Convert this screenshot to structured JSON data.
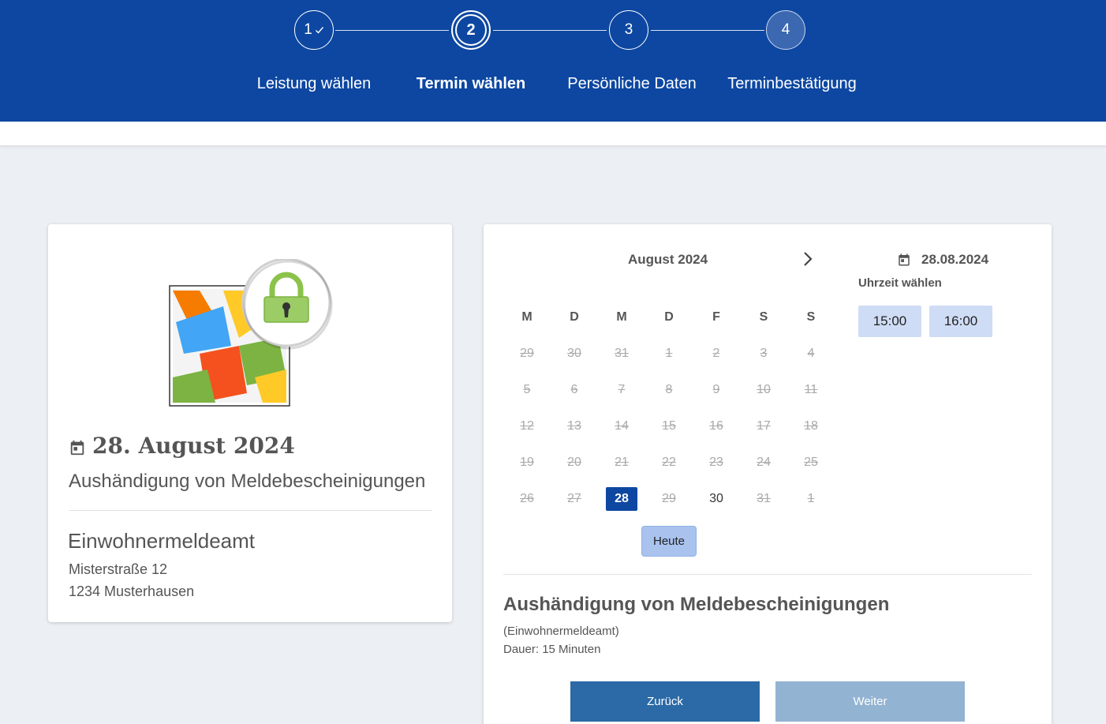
{
  "stepper": {
    "steps": [
      {
        "number": "1",
        "label": "Leistung wählen",
        "status": "completed"
      },
      {
        "number": "2",
        "label": "Termin wählen",
        "status": "active"
      },
      {
        "number": "3",
        "label": "Persönliche Daten",
        "status": "pending"
      },
      {
        "number": "4",
        "label": "Terminbestätigung",
        "status": "pending"
      }
    ]
  },
  "summary": {
    "date": "28. August 2024",
    "service": "Aushändigung von Meldebescheinigungen",
    "office": "Einwohnermeldeamt",
    "street": "Misterstraße 12",
    "city": "1234 Musterhausen"
  },
  "calendar": {
    "month_label": "August 2024",
    "weekdays": [
      "M",
      "D",
      "M",
      "D",
      "F",
      "S",
      "S"
    ],
    "weeks": [
      [
        {
          "d": "29",
          "s": "disabled"
        },
        {
          "d": "30",
          "s": "disabled"
        },
        {
          "d": "31",
          "s": "disabled"
        },
        {
          "d": "1",
          "s": "disabled"
        },
        {
          "d": "2",
          "s": "disabled"
        },
        {
          "d": "3",
          "s": "disabled"
        },
        {
          "d": "4",
          "s": "disabled"
        }
      ],
      [
        {
          "d": "5",
          "s": "disabled"
        },
        {
          "d": "6",
          "s": "disabled"
        },
        {
          "d": "7",
          "s": "disabled"
        },
        {
          "d": "8",
          "s": "disabled"
        },
        {
          "d": "9",
          "s": "disabled"
        },
        {
          "d": "10",
          "s": "disabled"
        },
        {
          "d": "11",
          "s": "disabled"
        }
      ],
      [
        {
          "d": "12",
          "s": "disabled"
        },
        {
          "d": "13",
          "s": "disabled"
        },
        {
          "d": "14",
          "s": "disabled"
        },
        {
          "d": "15",
          "s": "disabled"
        },
        {
          "d": "16",
          "s": "disabled"
        },
        {
          "d": "17",
          "s": "disabled"
        },
        {
          "d": "18",
          "s": "disabled"
        }
      ],
      [
        {
          "d": "19",
          "s": "disabled"
        },
        {
          "d": "20",
          "s": "disabled"
        },
        {
          "d": "21",
          "s": "disabled"
        },
        {
          "d": "22",
          "s": "disabled"
        },
        {
          "d": "23",
          "s": "disabled"
        },
        {
          "d": "24",
          "s": "disabled"
        },
        {
          "d": "25",
          "s": "disabled"
        }
      ],
      [
        {
          "d": "26",
          "s": "disabled"
        },
        {
          "d": "27",
          "s": "disabled"
        },
        {
          "d": "28",
          "s": "selected"
        },
        {
          "d": "29",
          "s": "disabled"
        },
        {
          "d": "30",
          "s": "available"
        },
        {
          "d": "31",
          "s": "disabled"
        },
        {
          "d": "1",
          "s": "disabled"
        }
      ]
    ],
    "today_label": "Heute"
  },
  "time_selection": {
    "selected_date": "28.08.2024",
    "heading": "Uhrzeit wählen",
    "slots": [
      "15:00",
      "16:00"
    ]
  },
  "details": {
    "title": "Aushändigung von Meldebescheinigungen",
    "office": "(Einwohnermeldeamt)",
    "duration": "Dauer: 15 Minuten"
  },
  "actions": {
    "back_label": "Zurück",
    "next_label": "Weiter"
  },
  "colors": {
    "header_blue": "#0d47a1",
    "selected_day": "#0d47a1",
    "time_slot": "#cfdcf5",
    "back_button": "#2b6aa6",
    "next_button_disabled": "#93b3d2"
  }
}
